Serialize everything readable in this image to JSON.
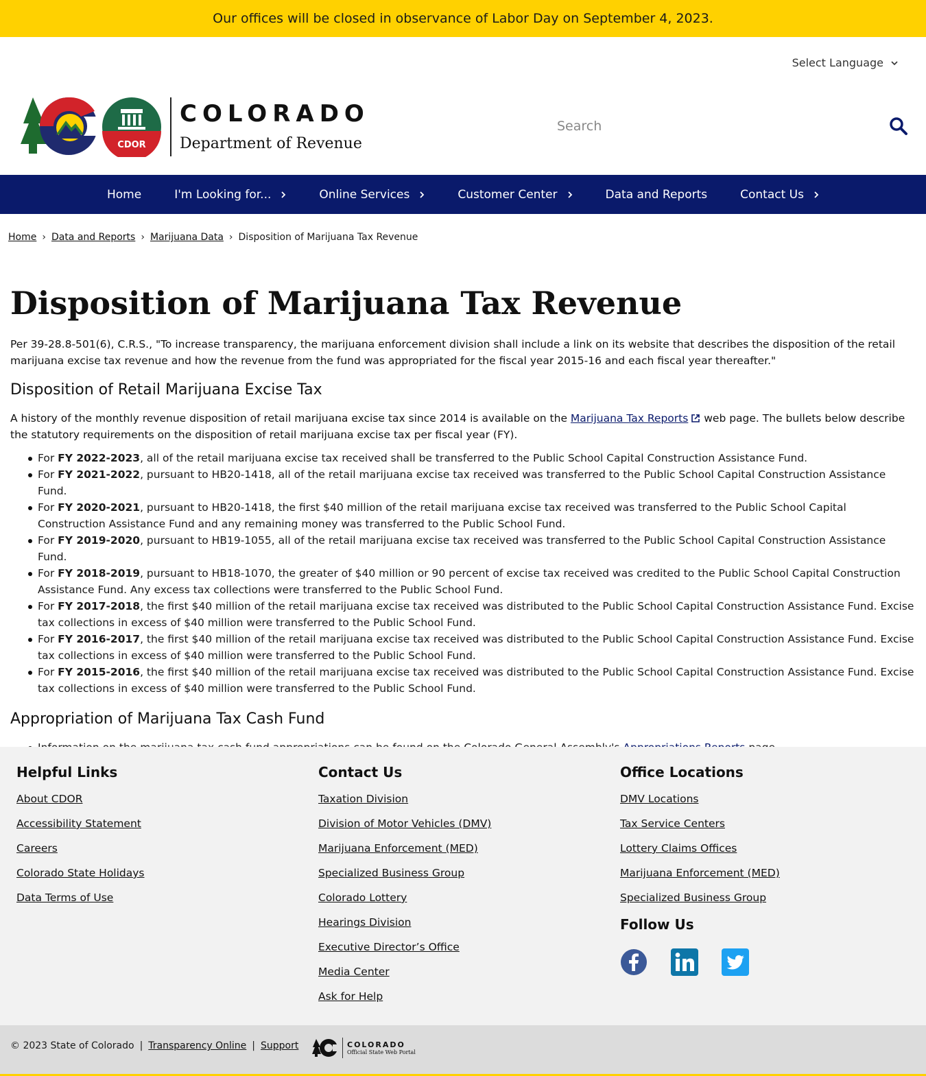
{
  "alert": {
    "text": "Our offices will be closed in observance of Labor Day on September 4, 2023."
  },
  "language": {
    "label": "Select Language"
  },
  "brand": {
    "state": "COLORADO",
    "dept": "Department of Revenue",
    "seal_text": "CDOR"
  },
  "search": {
    "placeholder": "Search"
  },
  "nav": {
    "items": [
      {
        "label": "Home"
      },
      {
        "label": "I'm Looking for..."
      },
      {
        "label": "Online Services"
      },
      {
        "label": "Customer Center"
      },
      {
        "label": "Data and Reports"
      },
      {
        "label": "Contact Us"
      }
    ]
  },
  "breadcrumb": {
    "home": "Home",
    "data": "Data and Reports",
    "mj": "Marijuana Data",
    "current": "Disposition of Marijuana Tax Revenue"
  },
  "page": {
    "title": "Disposition of Marijuana Tax Revenue",
    "intro": "Per 39-28.8-501(6), C.R.S., \"To increase transparency, the marijuana enforcement division shall include a link on its website that describes the disposition of the retail marijuana excise tax revenue and how the revenue from the fund was appropriated for the fiscal year 2015-16 and each fiscal year thereafter.\"",
    "h2_disposition": "Disposition of Retail Marijuana Excise Tax",
    "history_pre": "A history of the monthly revenue disposition of retail marijuana excise tax since 2014 is available on the ",
    "history_link": "Marijuana Tax Reports",
    "history_post": " web page. The bullets below describe the statutory requirements on the disposition of retail marijuana excise tax per fiscal year (FY).",
    "bullets": [
      {
        "fy": "FY 2022-2023",
        "text": ", all of the retail marijuana excise tax received shall be transferred to the Public School Capital Construction Assistance Fund."
      },
      {
        "fy": "FY 2021-2022",
        "text": ", pursuant to HB20-1418, all of the retail marijuana excise tax received was transferred to the Public School Capital Construction Assistance Fund."
      },
      {
        "fy": "FY 2020-2021",
        "text": ", pursuant to HB20-1418, the first $40 million of the retail marijuana excise tax received was transferred to the Public School Capital Construction Assistance Fund and any remaining money was transferred to the Public School Fund."
      },
      {
        "fy": "FY 2019-2020",
        "text": ", pursuant to HB19-1055, all of the retail marijuana excise tax received was transferred to the Public School Capital Construction Assistance Fund."
      },
      {
        "fy": "FY 2018-2019",
        "text": ", pursuant to HB18-1070, the greater of $40 million or 90 percent of excise tax received was credited to the Public School Capital Construction Assistance Fund. Any excess tax collections were transferred to the Public School Fund."
      },
      {
        "fy": "FY 2017-2018",
        "text": ", the first $40 million of the retail marijuana excise tax received was distributed to the Public School Capital Construction Assistance Fund. Excise tax collections in excess of $40 million were transferred to the Public School Fund."
      },
      {
        "fy": "FY 2016-2017",
        "text": ", the first $40 million of the retail marijuana excise tax received was distributed to the Public School Capital Construction Assistance Fund. Excise tax collections in excess of $40 million were transferred to the Public School Fund."
      },
      {
        "fy": "FY 2015-2016",
        "text": ", the first $40 million of the retail marijuana excise tax received was distributed to the Public School Capital Construction Assistance Fund. Excise tax collections in excess of $40 million were transferred to the Public School Fund."
      }
    ],
    "bullet_prefix": "For ",
    "h2_appropriation": "Appropriation of Marijuana Tax Cash Fund",
    "approp_pre": "Information on the marijuana tax cash fund appropriations can be found on the Colorado General Assembly's ",
    "approp_link": "Appropriations Reports",
    "approp_post": " page."
  },
  "footer": {
    "helpful": {
      "title": "Helpful Links",
      "links": [
        "About CDOR",
        "Accessibility Statement",
        "Careers",
        "Colorado State Holidays",
        "Data Terms of Use"
      ]
    },
    "contact": {
      "title": "Contact Us",
      "links": [
        "Taxation Division",
        "Division of Motor Vehicles (DMV)",
        "Marijuana Enforcement (MED)",
        "Specialized Business Group",
        "Colorado Lottery",
        "Hearings Division",
        "Executive Director’s Office",
        "Media Center",
        "Ask for Help"
      ]
    },
    "offices": {
      "title": "Office Locations",
      "links": [
        "DMV Locations",
        "Tax Service Centers",
        "Lottery Claims Offices",
        "Marijuana Enforcement (MED)",
        "Specialized Business Group"
      ]
    },
    "follow": {
      "title": "Follow Us"
    }
  },
  "bottom": {
    "copyright": "© 2023 State of Colorado",
    "sep": "|",
    "transparency": "Transparency Online",
    "support": "Support",
    "portal_state": "COLORADO",
    "portal_sub": "Official State Web Portal"
  },
  "colors": {
    "alert": "#ffd100",
    "nav": "#0a1a6b",
    "footer": "#f2f2f2",
    "bottom": "#dcdcdc"
  }
}
